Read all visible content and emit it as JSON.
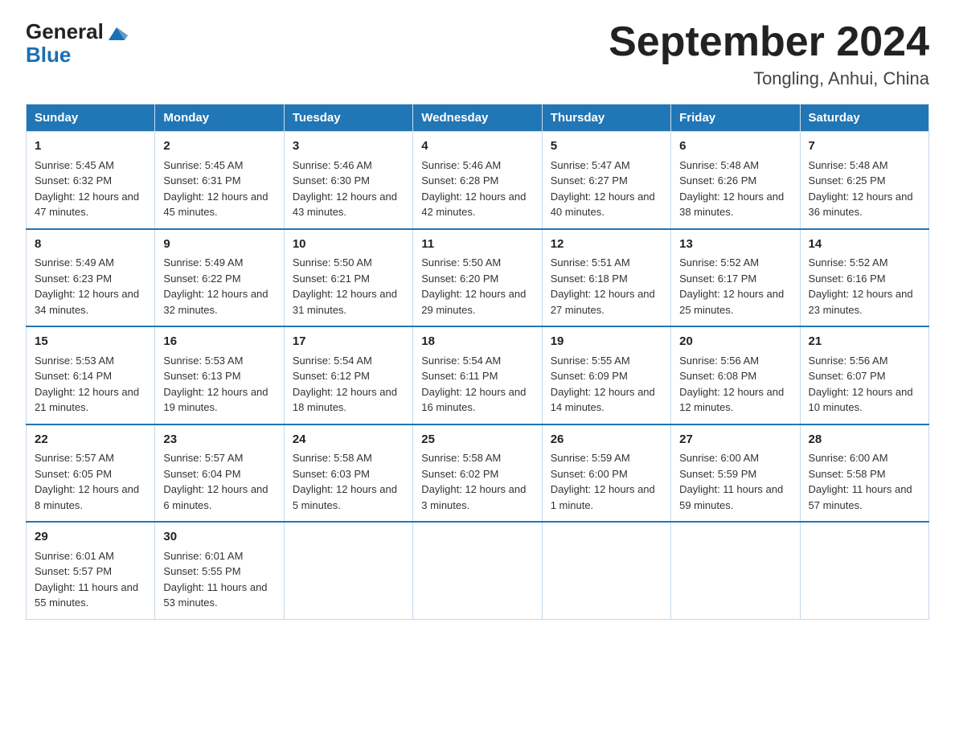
{
  "header": {
    "logo_general": "General",
    "logo_blue": "Blue",
    "main_title": "September 2024",
    "subtitle": "Tongling, Anhui, China"
  },
  "days_of_week": [
    "Sunday",
    "Monday",
    "Tuesday",
    "Wednesday",
    "Thursday",
    "Friday",
    "Saturday"
  ],
  "weeks": [
    [
      {
        "day": "1",
        "sunrise": "5:45 AM",
        "sunset": "6:32 PM",
        "daylight": "12 hours and 47 minutes."
      },
      {
        "day": "2",
        "sunrise": "5:45 AM",
        "sunset": "6:31 PM",
        "daylight": "12 hours and 45 minutes."
      },
      {
        "day": "3",
        "sunrise": "5:46 AM",
        "sunset": "6:30 PM",
        "daylight": "12 hours and 43 minutes."
      },
      {
        "day": "4",
        "sunrise": "5:46 AM",
        "sunset": "6:28 PM",
        "daylight": "12 hours and 42 minutes."
      },
      {
        "day": "5",
        "sunrise": "5:47 AM",
        "sunset": "6:27 PM",
        "daylight": "12 hours and 40 minutes."
      },
      {
        "day": "6",
        "sunrise": "5:48 AM",
        "sunset": "6:26 PM",
        "daylight": "12 hours and 38 minutes."
      },
      {
        "day": "7",
        "sunrise": "5:48 AM",
        "sunset": "6:25 PM",
        "daylight": "12 hours and 36 minutes."
      }
    ],
    [
      {
        "day": "8",
        "sunrise": "5:49 AM",
        "sunset": "6:23 PM",
        "daylight": "12 hours and 34 minutes."
      },
      {
        "day": "9",
        "sunrise": "5:49 AM",
        "sunset": "6:22 PM",
        "daylight": "12 hours and 32 minutes."
      },
      {
        "day": "10",
        "sunrise": "5:50 AM",
        "sunset": "6:21 PM",
        "daylight": "12 hours and 31 minutes."
      },
      {
        "day": "11",
        "sunrise": "5:50 AM",
        "sunset": "6:20 PM",
        "daylight": "12 hours and 29 minutes."
      },
      {
        "day": "12",
        "sunrise": "5:51 AM",
        "sunset": "6:18 PM",
        "daylight": "12 hours and 27 minutes."
      },
      {
        "day": "13",
        "sunrise": "5:52 AM",
        "sunset": "6:17 PM",
        "daylight": "12 hours and 25 minutes."
      },
      {
        "day": "14",
        "sunrise": "5:52 AM",
        "sunset": "6:16 PM",
        "daylight": "12 hours and 23 minutes."
      }
    ],
    [
      {
        "day": "15",
        "sunrise": "5:53 AM",
        "sunset": "6:14 PM",
        "daylight": "12 hours and 21 minutes."
      },
      {
        "day": "16",
        "sunrise": "5:53 AM",
        "sunset": "6:13 PM",
        "daylight": "12 hours and 19 minutes."
      },
      {
        "day": "17",
        "sunrise": "5:54 AM",
        "sunset": "6:12 PM",
        "daylight": "12 hours and 18 minutes."
      },
      {
        "day": "18",
        "sunrise": "5:54 AM",
        "sunset": "6:11 PM",
        "daylight": "12 hours and 16 minutes."
      },
      {
        "day": "19",
        "sunrise": "5:55 AM",
        "sunset": "6:09 PM",
        "daylight": "12 hours and 14 minutes."
      },
      {
        "day": "20",
        "sunrise": "5:56 AM",
        "sunset": "6:08 PM",
        "daylight": "12 hours and 12 minutes."
      },
      {
        "day": "21",
        "sunrise": "5:56 AM",
        "sunset": "6:07 PM",
        "daylight": "12 hours and 10 minutes."
      }
    ],
    [
      {
        "day": "22",
        "sunrise": "5:57 AM",
        "sunset": "6:05 PM",
        "daylight": "12 hours and 8 minutes."
      },
      {
        "day": "23",
        "sunrise": "5:57 AM",
        "sunset": "6:04 PM",
        "daylight": "12 hours and 6 minutes."
      },
      {
        "day": "24",
        "sunrise": "5:58 AM",
        "sunset": "6:03 PM",
        "daylight": "12 hours and 5 minutes."
      },
      {
        "day": "25",
        "sunrise": "5:58 AM",
        "sunset": "6:02 PM",
        "daylight": "12 hours and 3 minutes."
      },
      {
        "day": "26",
        "sunrise": "5:59 AM",
        "sunset": "6:00 PM",
        "daylight": "12 hours and 1 minute."
      },
      {
        "day": "27",
        "sunrise": "6:00 AM",
        "sunset": "5:59 PM",
        "daylight": "11 hours and 59 minutes."
      },
      {
        "day": "28",
        "sunrise": "6:00 AM",
        "sunset": "5:58 PM",
        "daylight": "11 hours and 57 minutes."
      }
    ],
    [
      {
        "day": "29",
        "sunrise": "6:01 AM",
        "sunset": "5:57 PM",
        "daylight": "11 hours and 55 minutes."
      },
      {
        "day": "30",
        "sunrise": "6:01 AM",
        "sunset": "5:55 PM",
        "daylight": "11 hours and 53 minutes."
      },
      null,
      null,
      null,
      null,
      null
    ]
  ],
  "labels": {
    "sunrise": "Sunrise: ",
    "sunset": "Sunset: ",
    "daylight": "Daylight: "
  }
}
